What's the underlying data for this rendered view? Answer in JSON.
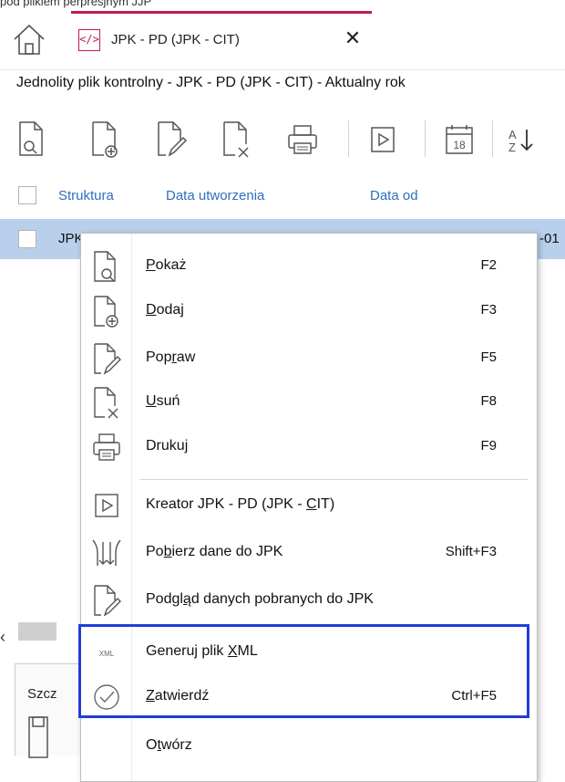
{
  "top_cut_text": "pod plikiem perpresjnym JJP",
  "tab": {
    "icon": "xml-code-icon",
    "title": "JPK - PD (JPK - CIT)"
  },
  "module_title": "Jednolity plik kontrolny - JPK - PD (JPK - CIT) - Aktualny rok",
  "toolbar": {
    "calendar_day": "18",
    "sort_label": "A Z"
  },
  "columns": [
    "Struktura",
    "Data utworzenia",
    "Data od"
  ],
  "row": {
    "struktura": "JPK",
    "date_tail": "-01"
  },
  "bottom": {
    "tab_label": "Szcz"
  },
  "menu": {
    "items": [
      {
        "label_pre": "",
        "label_u": "P",
        "label_post": "okaż",
        "shortcut": "F2",
        "icon": "show-document-icon"
      },
      {
        "label_pre": "",
        "label_u": "D",
        "label_post": "odaj",
        "shortcut": "F3",
        "icon": "add-document-icon"
      },
      {
        "label_pre": "Pop",
        "label_u": "r",
        "label_post": "aw",
        "shortcut": "F5",
        "icon": "edit-document-icon"
      },
      {
        "label_pre": "",
        "label_u": "U",
        "label_post": "suń",
        "shortcut": "F8",
        "icon": "delete-document-icon"
      },
      {
        "label_pre": "Druku",
        "label_u": "j",
        "label_post": "",
        "shortcut": "F9",
        "icon": "print-icon"
      },
      {
        "label_pre": "Kreator JPK - PD (JPK - ",
        "label_u": "C",
        "label_post": "IT)",
        "shortcut": "",
        "icon": "wizard-play-icon"
      },
      {
        "label_pre": "Po",
        "label_u": "b",
        "label_post": "ierz dane do JPK",
        "shortcut": "Shift+F3",
        "icon": "download-data-icon"
      },
      {
        "label_pre": "Podgl",
        "label_u": "ą",
        "label_post": "d danych pobranych do JPK",
        "shortcut": "",
        "icon": "preview-document-icon"
      },
      {
        "label_pre": "Generuj plik ",
        "label_u": "X",
        "label_post": "ML",
        "shortcut": "",
        "icon": "xml-file-icon"
      },
      {
        "label_pre": "",
        "label_u": "Z",
        "label_post": "atwierdź",
        "shortcut": "Ctrl+F5",
        "icon": "confirm-check-icon"
      },
      {
        "label_pre": "O",
        "label_u": "t",
        "label_post": "wórz",
        "shortcut": "",
        "icon": "open-icon"
      }
    ]
  },
  "colors": {
    "accent_tab": "#c2185b",
    "selection": "#b8d0ec",
    "highlight_box": "#1f3ddb",
    "header_link": "#2f6fbd"
  }
}
